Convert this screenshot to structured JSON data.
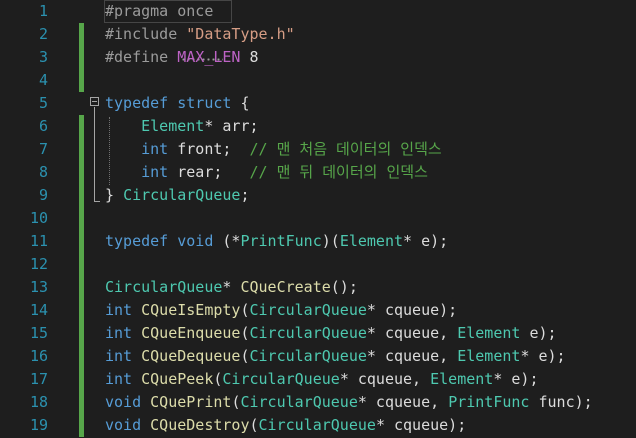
{
  "colors": {
    "background": "#1e1e1e",
    "line_number": "#2b91af",
    "change_bar": "#57a64a",
    "keyword": "#569cd6",
    "type": "#4ec9b0",
    "function": "#dcdcaa",
    "macro": "#bd63c5",
    "string": "#d69d85",
    "comment": "#57a64a",
    "preprocessor": "#9b9b9b",
    "default": "#dcdcdc"
  },
  "lines": [
    {
      "n": "1",
      "changed": false,
      "tokens": [
        {
          "t": "#pragma once",
          "c": "preprocessor"
        }
      ]
    },
    {
      "n": "2",
      "changed": true,
      "tokens": [
        {
          "t": "#include ",
          "c": "preprocessor"
        },
        {
          "t": "\"DataType.h\"",
          "c": "string"
        }
      ]
    },
    {
      "n": "3",
      "changed": true,
      "tokens": [
        {
          "t": "#define ",
          "c": "preprocessor"
        },
        {
          "t": "MAX_LEN",
          "c": "macro"
        },
        {
          "t": " 8",
          "c": "default"
        }
      ]
    },
    {
      "n": "4",
      "changed": true,
      "tokens": []
    },
    {
      "n": "5",
      "changed": false,
      "tokens": [
        {
          "t": "typedef",
          "c": "keyword"
        },
        {
          "t": " ",
          "c": "default"
        },
        {
          "t": "struct",
          "c": "keyword"
        },
        {
          "t": " {",
          "c": "default"
        }
      ]
    },
    {
      "n": "6",
      "changed": true,
      "tokens": [
        {
          "t": "    ",
          "c": "default"
        },
        {
          "t": "Element",
          "c": "type"
        },
        {
          "t": "* arr;",
          "c": "default"
        }
      ]
    },
    {
      "n": "7",
      "changed": true,
      "tokens": [
        {
          "t": "    ",
          "c": "default"
        },
        {
          "t": "int",
          "c": "keyword"
        },
        {
          "t": " front;  ",
          "c": "default"
        },
        {
          "t": "// 맨 처음 데이터의 인덱스",
          "c": "comment"
        }
      ]
    },
    {
      "n": "8",
      "changed": true,
      "tokens": [
        {
          "t": "    ",
          "c": "default"
        },
        {
          "t": "int",
          "c": "keyword"
        },
        {
          "t": " rear;   ",
          "c": "default"
        },
        {
          "t": "// 맨 뒤 데이터의 인덱스",
          "c": "comment"
        }
      ]
    },
    {
      "n": "9",
      "changed": true,
      "tokens": [
        {
          "t": "} ",
          "c": "default"
        },
        {
          "t": "CircularQueue",
          "c": "type"
        },
        {
          "t": ";",
          "c": "default"
        }
      ]
    },
    {
      "n": "10",
      "changed": true,
      "tokens": []
    },
    {
      "n": "11",
      "changed": true,
      "tokens": [
        {
          "t": "typedef",
          "c": "keyword"
        },
        {
          "t": " ",
          "c": "default"
        },
        {
          "t": "void",
          "c": "keyword"
        },
        {
          "t": " (*",
          "c": "default"
        },
        {
          "t": "PrintFunc",
          "c": "type"
        },
        {
          "t": ")(",
          "c": "default"
        },
        {
          "t": "Element",
          "c": "type"
        },
        {
          "t": "* e);",
          "c": "default"
        }
      ]
    },
    {
      "n": "12",
      "changed": true,
      "tokens": []
    },
    {
      "n": "13",
      "changed": true,
      "tokens": [
        {
          "t": "CircularQueue",
          "c": "type"
        },
        {
          "t": "* ",
          "c": "default"
        },
        {
          "t": "CQueCreate",
          "c": "function"
        },
        {
          "t": "();",
          "c": "default"
        }
      ]
    },
    {
      "n": "14",
      "changed": true,
      "tokens": [
        {
          "t": "int",
          "c": "keyword"
        },
        {
          "t": " ",
          "c": "default"
        },
        {
          "t": "CQueIsEmpty",
          "c": "function"
        },
        {
          "t": "(",
          "c": "default"
        },
        {
          "t": "CircularQueue",
          "c": "type"
        },
        {
          "t": "* cqueue);",
          "c": "default"
        }
      ]
    },
    {
      "n": "15",
      "changed": true,
      "tokens": [
        {
          "t": "int",
          "c": "keyword"
        },
        {
          "t": " ",
          "c": "default"
        },
        {
          "t": "CQueEnqueue",
          "c": "function"
        },
        {
          "t": "(",
          "c": "default"
        },
        {
          "t": "CircularQueue",
          "c": "type"
        },
        {
          "t": "* cqueue, ",
          "c": "default"
        },
        {
          "t": "Element",
          "c": "type"
        },
        {
          "t": " e);",
          "c": "default"
        }
      ]
    },
    {
      "n": "16",
      "changed": true,
      "tokens": [
        {
          "t": "int",
          "c": "keyword"
        },
        {
          "t": " ",
          "c": "default"
        },
        {
          "t": "CQueDequeue",
          "c": "function"
        },
        {
          "t": "(",
          "c": "default"
        },
        {
          "t": "CircularQueue",
          "c": "type"
        },
        {
          "t": "* cqueue, ",
          "c": "default"
        },
        {
          "t": "Element",
          "c": "type"
        },
        {
          "t": "* e);",
          "c": "default"
        }
      ]
    },
    {
      "n": "17",
      "changed": true,
      "tokens": [
        {
          "t": "int",
          "c": "keyword"
        },
        {
          "t": " ",
          "c": "default"
        },
        {
          "t": "CQuePeek",
          "c": "function"
        },
        {
          "t": "(",
          "c": "default"
        },
        {
          "t": "CircularQueue",
          "c": "type"
        },
        {
          "t": "* cqueue, ",
          "c": "default"
        },
        {
          "t": "Element",
          "c": "type"
        },
        {
          "t": "* e);",
          "c": "default"
        }
      ]
    },
    {
      "n": "18",
      "changed": true,
      "tokens": [
        {
          "t": "void",
          "c": "keyword"
        },
        {
          "t": " ",
          "c": "default"
        },
        {
          "t": "CQuePrint",
          "c": "function"
        },
        {
          "t": "(",
          "c": "default"
        },
        {
          "t": "CircularQueue",
          "c": "type"
        },
        {
          "t": "* cqueue, ",
          "c": "default"
        },
        {
          "t": "PrintFunc",
          "c": "type"
        },
        {
          "t": " func);",
          "c": "default"
        }
      ]
    },
    {
      "n": "19",
      "changed": true,
      "tokens": [
        {
          "t": "void",
          "c": "keyword"
        },
        {
          "t": " ",
          "c": "default"
        },
        {
          "t": "CQueDestroy",
          "c": "function"
        },
        {
          "t": "(",
          "c": "default"
        },
        {
          "t": "CircularQueue",
          "c": "type"
        },
        {
          "t": "* cqueue);",
          "c": "default"
        }
      ]
    }
  ]
}
